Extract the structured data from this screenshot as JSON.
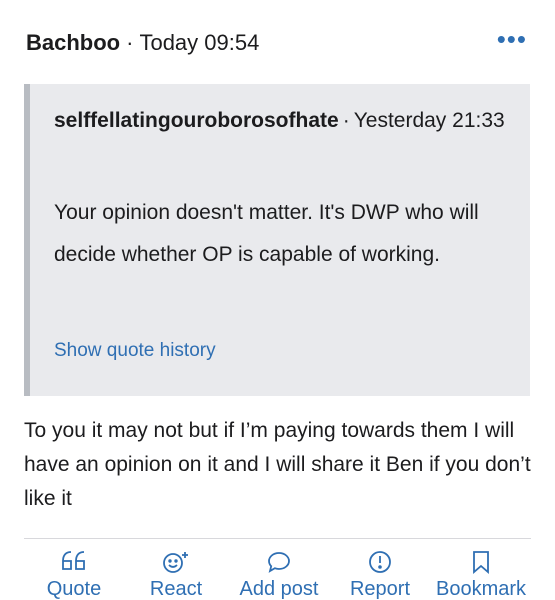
{
  "post": {
    "author": "Bachboo",
    "separator": "·",
    "time": "Today 09:54",
    "more_icon": "more-dots-icon",
    "body": "To you it may not but if I’m paying towards them I will have an opinion on it and I will share it Ben if you don’t like it"
  },
  "quote": {
    "author": "selffellatingouroborosofhate",
    "separator": "·",
    "time": "Yesterday 21:33",
    "text": "Your opinion doesn't matter. It's DWP who will decide whether OP is capable of working.",
    "history_link": "Show quote history"
  },
  "actions": {
    "quote": {
      "label": "Quote",
      "icon": "quote-icon"
    },
    "react": {
      "label": "React",
      "icon": "react-smiley-icon"
    },
    "add_post": {
      "label": "Add post",
      "icon": "speech-bubble-icon"
    },
    "report": {
      "label": "Report",
      "icon": "report-exclamation-icon"
    },
    "bookmark": {
      "label": "Bookmark",
      "icon": "bookmark-icon"
    }
  },
  "colors": {
    "accent": "#2f6fb3",
    "quote_bg": "#e9eaed",
    "quote_border": "#b8bcc2",
    "text": "#1c1c1e"
  }
}
